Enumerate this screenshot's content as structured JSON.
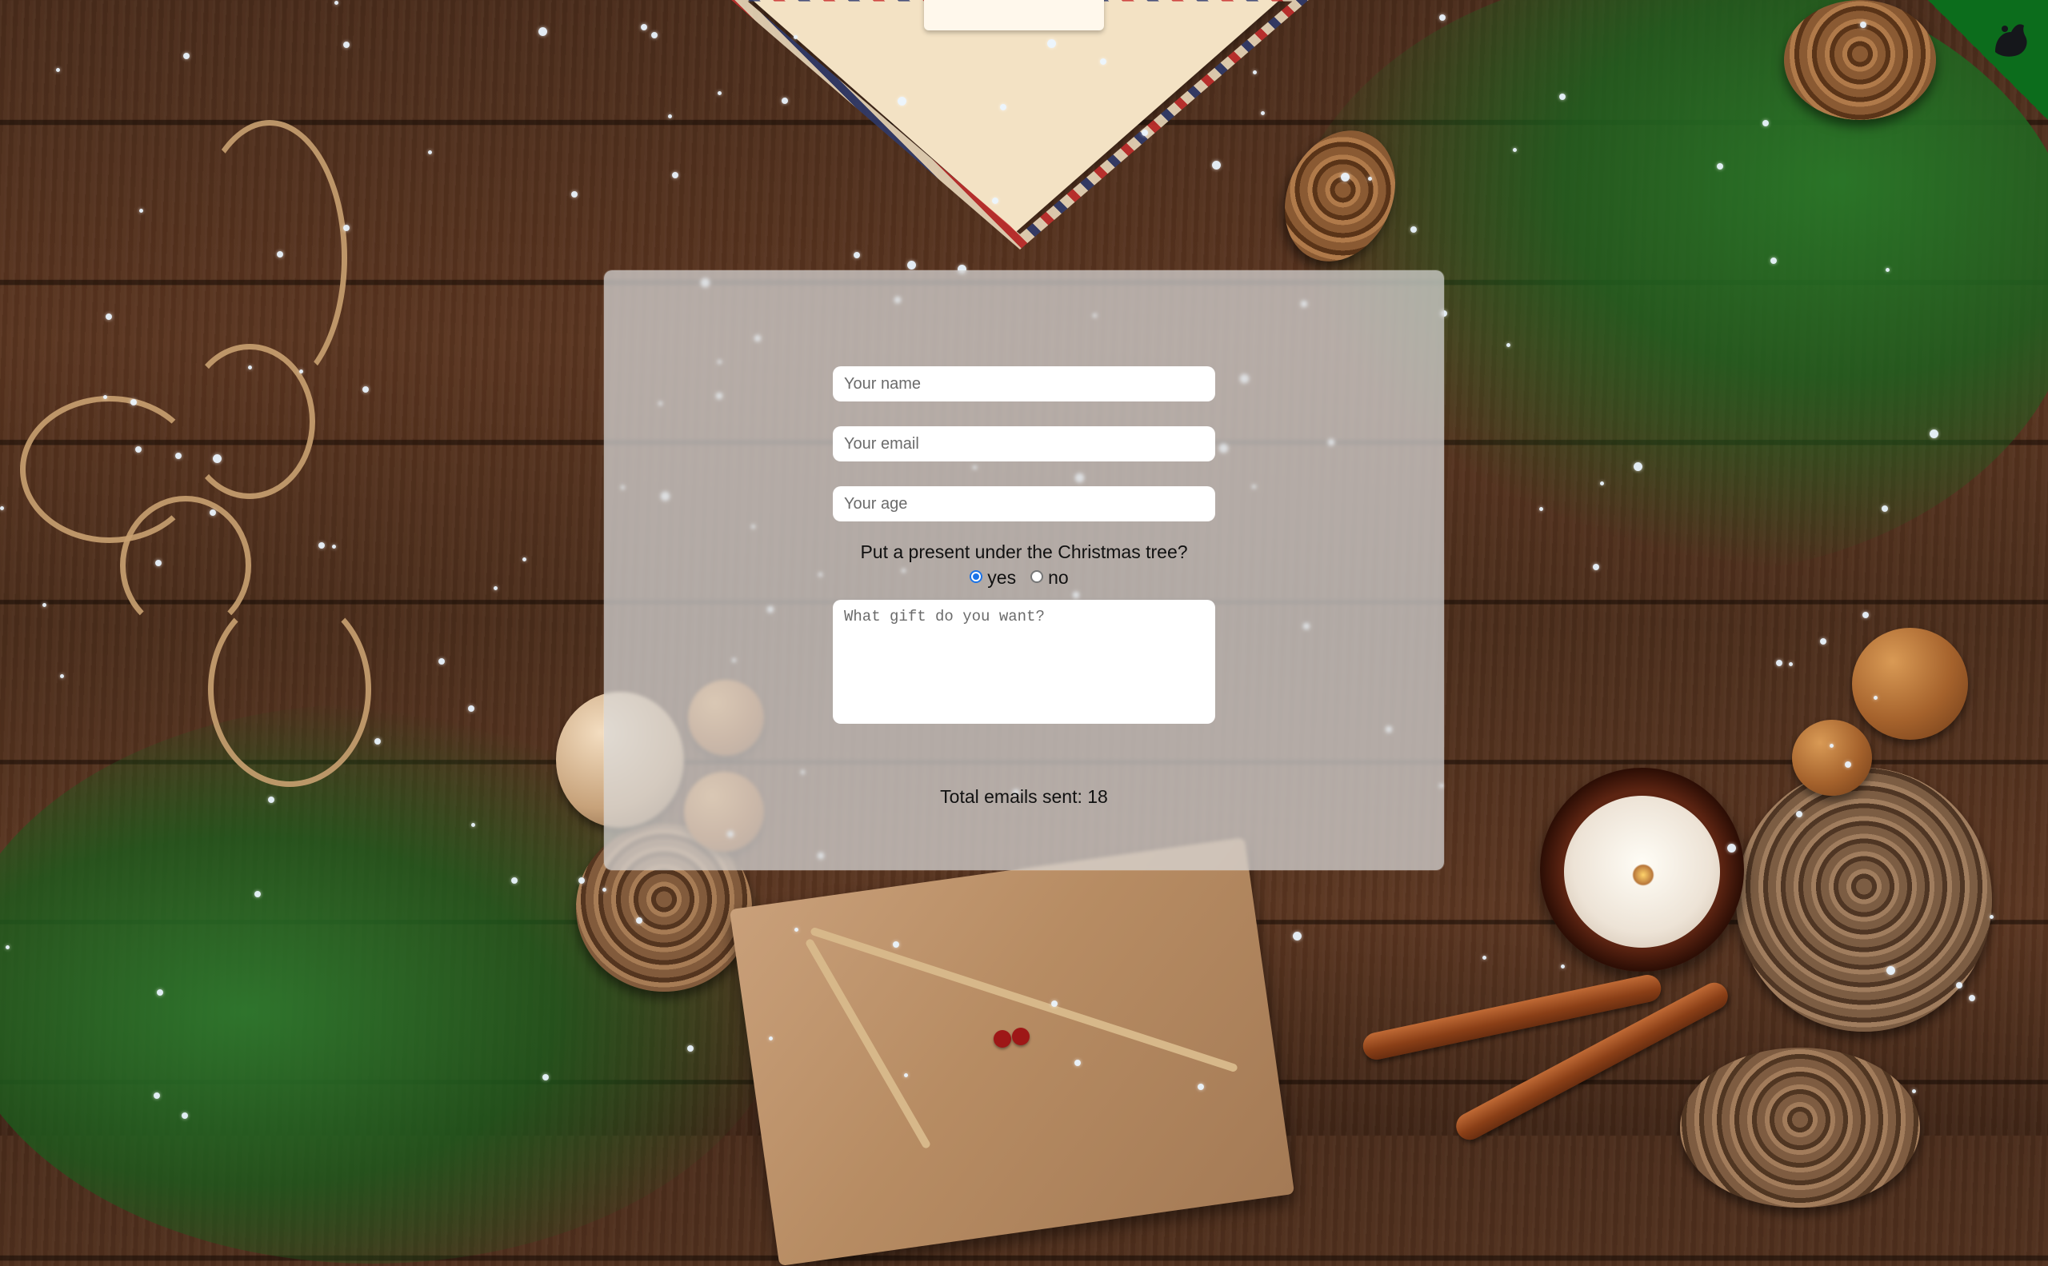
{
  "form": {
    "name_placeholder": "Your name",
    "email_placeholder": "Your email",
    "age_placeholder": "Your age",
    "present_question": "Put a present under the Christmas tree?",
    "radio_options": [
      {
        "label": "yes",
        "selected": true
      },
      {
        "label": "no",
        "selected": false
      }
    ],
    "gift_placeholder": "What gift do you want?"
  },
  "stats": {
    "emails_sent_text": "Total emails sent: 18",
    "emails_sent_count": 18
  },
  "colors": {
    "card_background": "#dadada",
    "radio_accent": "#1a73e8",
    "corner_ribbon": "#0c6d1c"
  },
  "icons": {
    "corner": "github-cat-icon"
  }
}
